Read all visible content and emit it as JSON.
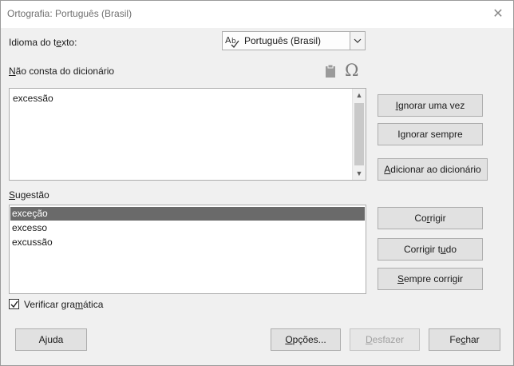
{
  "window": {
    "title": "Ortografia: Português (Brasil)"
  },
  "language": {
    "label_pre": "Idioma do t",
    "label_key": "e",
    "label_post": "xto:",
    "selected": "Português (Brasil)"
  },
  "not_in_dictionary": {
    "label_key": "N",
    "label_post": "ão consta do dicionário",
    "text": "excessão"
  },
  "suggestions": {
    "label_key": "S",
    "label_post": "ugestão",
    "items": [
      "exceção",
      "excesso",
      "excussão"
    ],
    "selected_index": 0
  },
  "buttons": {
    "ignore_once": {
      "key": "I",
      "post": "gnorar uma vez"
    },
    "ignore_all": {
      "pre": "I",
      "key": "g",
      "post": "norar sempre"
    },
    "add_to_dictionary": {
      "key": "A",
      "post": "dicionar ao dicionário"
    },
    "correct": {
      "pre": "Co",
      "key": "r",
      "post": "rigir"
    },
    "correct_all": {
      "pre": "Corrigir t",
      "key": "u",
      "post": "do"
    },
    "always_correct": {
      "key": "S",
      "post": "empre corrigir"
    },
    "help": {
      "pre": "A",
      "key": "j",
      "post": "uda"
    },
    "options": {
      "key": "O",
      "post": "pções..."
    },
    "undo": {
      "key": "D",
      "post": "esfazer"
    },
    "close": {
      "pre": "Fe",
      "key": "c",
      "post": "har"
    }
  },
  "check_grammar": {
    "pre": "Verificar gra",
    "key": "m",
    "post": "ática",
    "checked": true
  },
  "icons": {
    "close": "close-icon",
    "language": "spellcheck-language-icon",
    "dropdown": "chevron-down-icon",
    "paste": "paste-icon",
    "special_character": "omega-icon"
  },
  "colors": {
    "selection": "#6a6a6a",
    "button": "#e1e1e1",
    "border": "#adadad"
  }
}
